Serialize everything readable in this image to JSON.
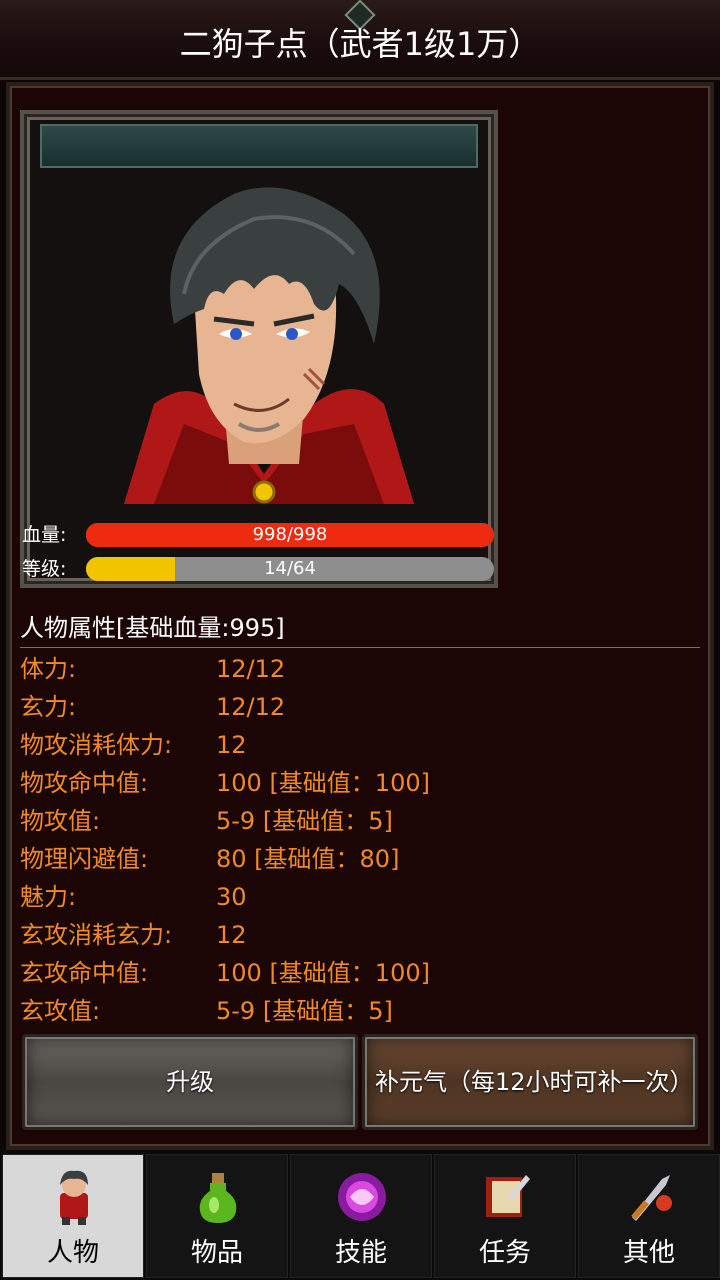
{
  "title": "二狗子点（武者1级1万）",
  "hp": {
    "label": "血量:",
    "text": "998/998",
    "fraction": 1.0
  },
  "level": {
    "label": "等级:",
    "text": "14/64",
    "fraction": 0.219
  },
  "stats_header": "人物属性[基础血量:995]",
  "stats": [
    {
      "name": "体力:",
      "value": "12/12"
    },
    {
      "name": "玄力:",
      "value": "12/12"
    },
    {
      "name": "物攻消耗体力:",
      "value": "12"
    },
    {
      "name": "物攻命中值:",
      "value": "100 [基础值：100]"
    },
    {
      "name": "物攻值:",
      "value": "5-9 [基础值：5]"
    },
    {
      "name": "物理闪避值:",
      "value": "80 [基础值：80]"
    },
    {
      "name": "魅力:",
      "value": "30"
    },
    {
      "name": "玄攻消耗玄力:",
      "value": "12"
    },
    {
      "name": "玄攻命中值:",
      "value": "100 [基础值：100]"
    },
    {
      "name": "玄攻值:",
      "value": "5-9 [基础值：5]"
    }
  ],
  "buttons": {
    "upgrade": "升级",
    "restore": "补元气（每12小时可补一次）"
  },
  "nav": [
    {
      "label": "人物",
      "icon": "character-icon",
      "active": true
    },
    {
      "label": "物品",
      "icon": "potion-icon",
      "active": false
    },
    {
      "label": "技能",
      "icon": "skill-orb-icon",
      "active": false
    },
    {
      "label": "任务",
      "icon": "quest-book-icon",
      "active": false
    },
    {
      "label": "其他",
      "icon": "sword-icon",
      "active": false
    }
  ],
  "colors": {
    "hp_fill": "#ee2a10",
    "level_fill": "#f2c400",
    "stat_text": "#f08a28"
  }
}
